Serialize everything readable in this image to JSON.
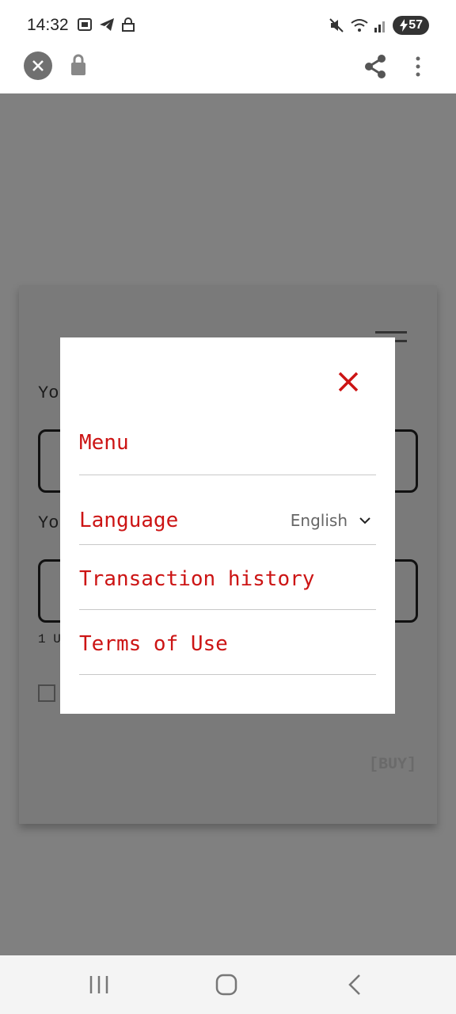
{
  "status_bar": {
    "time": "14:32",
    "battery": "57",
    "left_icons": [
      "screenshot-icon",
      "telegram-icon",
      "vpn-lock-icon"
    ],
    "right_icons": [
      "mute-icon",
      "wifi-icon",
      "signal-icon"
    ]
  },
  "browser": {
    "url_text": ""
  },
  "page": {
    "buy_label": "[BUY]",
    "label_fragment_1": "Yo",
    "label_fragment_2": "Yo",
    "rate_fragment": "1 U"
  },
  "modal": {
    "title": "Menu",
    "items": [
      {
        "label": "Language",
        "value": "English"
      },
      {
        "label": "Transaction history"
      },
      {
        "label": "Terms of Use"
      }
    ]
  },
  "colors": {
    "accent": "#cc1414",
    "overlay": "#808080"
  }
}
